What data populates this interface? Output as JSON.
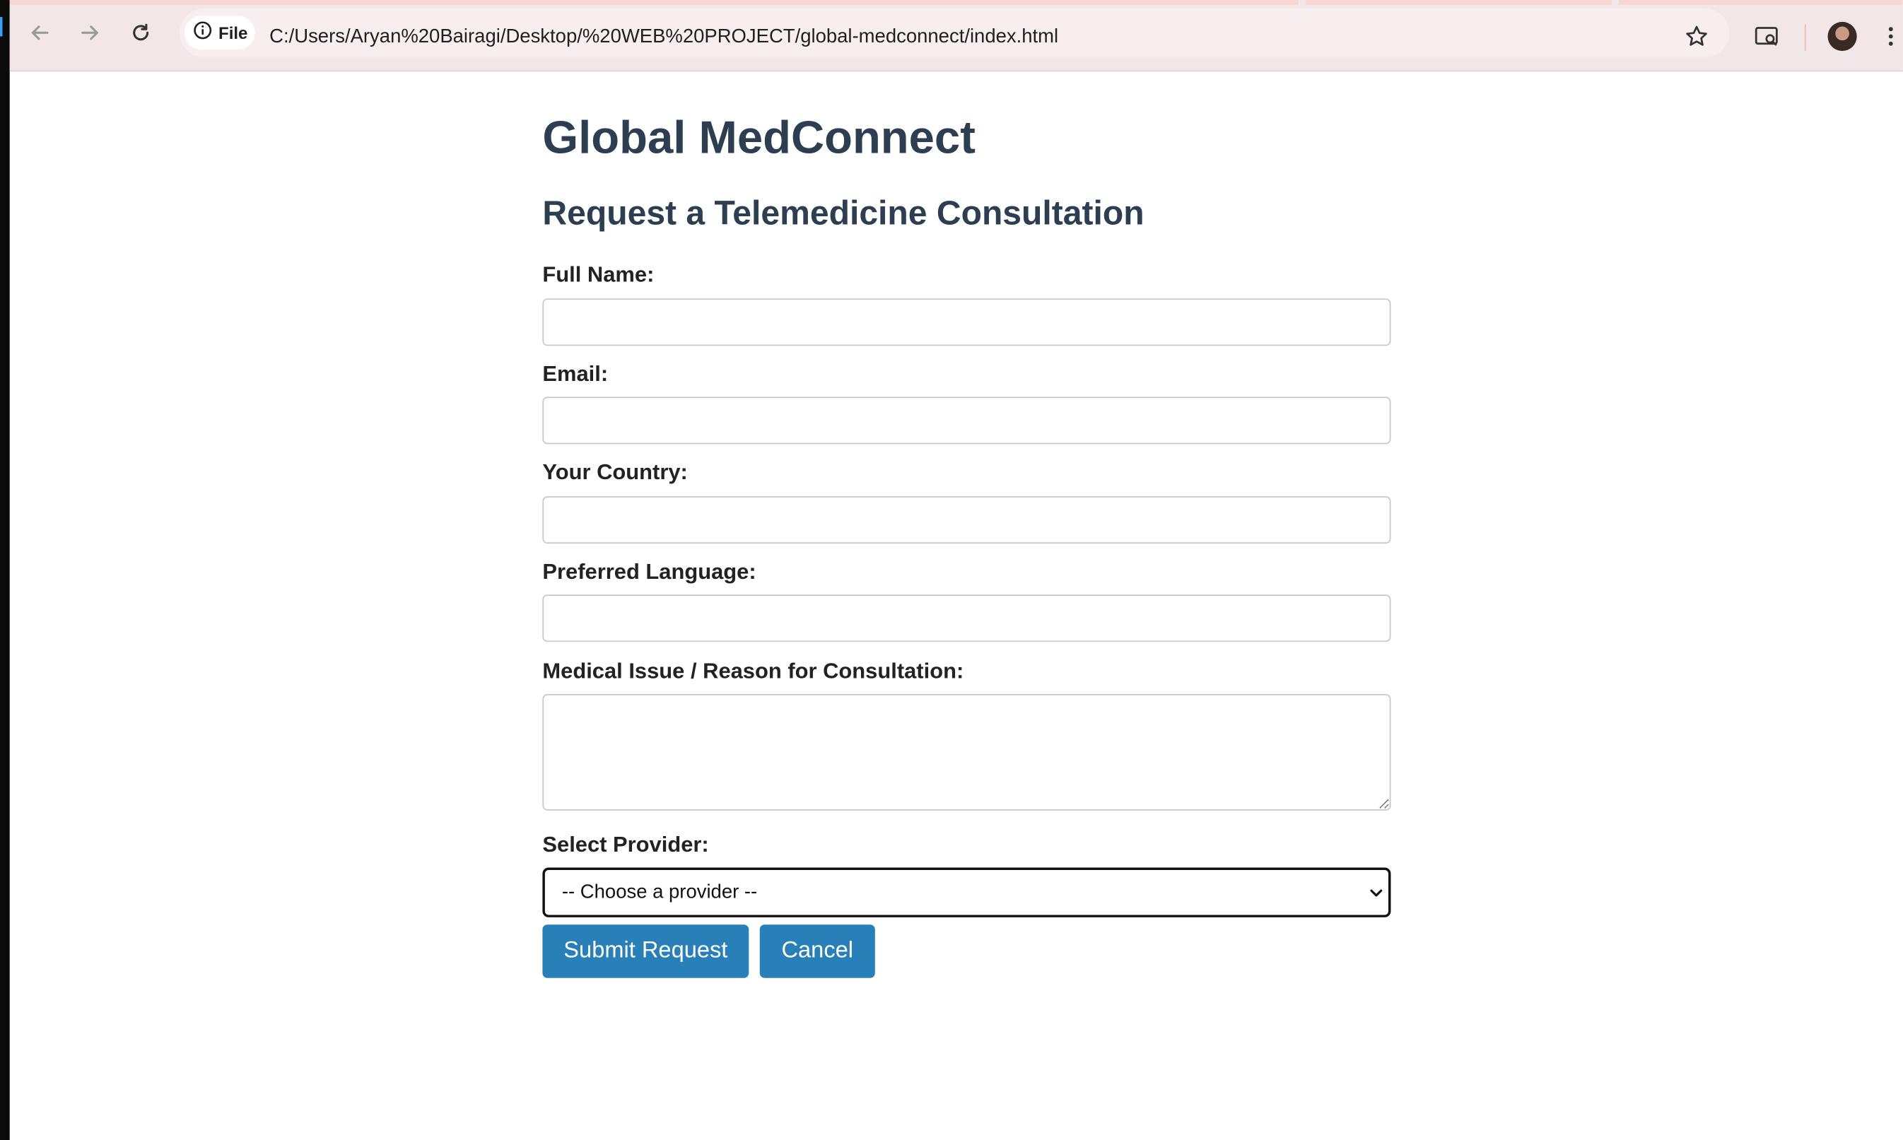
{
  "browser": {
    "site_chip_label": "File",
    "url": "C:/Users/Aryan%20Bairagi/Desktop/%20WEB%20PROJECT/global-medconnect/index.html",
    "icons": {
      "back": "arrow-left-icon",
      "forward": "arrow-right-icon",
      "reload": "reload-icon",
      "info": "info-icon",
      "bookmark": "star-icon",
      "search_tab": "tab-search-icon",
      "profile": "avatar",
      "menu": "kebab-menu-icon"
    }
  },
  "page": {
    "title": "Global MedConnect",
    "subtitle": "Request a Telemedicine Consultation"
  },
  "form": {
    "full_name_label": "Full Name:",
    "full_name_value": "",
    "email_label": "Email:",
    "email_value": "",
    "country_label": "Your Country:",
    "country_value": "",
    "language_label": "Preferred Language:",
    "language_value": "",
    "issue_label": "Medical Issue / Reason for Consultation:",
    "issue_value": "",
    "provider_label": "Select Provider:",
    "provider_selected": "-- Choose a provider --",
    "submit_label": "Submit Request",
    "cancel_label": "Cancel"
  },
  "colors": {
    "heading": "#2c3e50",
    "button": "#2980b9",
    "chrome_bg": "#f3e6e8"
  }
}
